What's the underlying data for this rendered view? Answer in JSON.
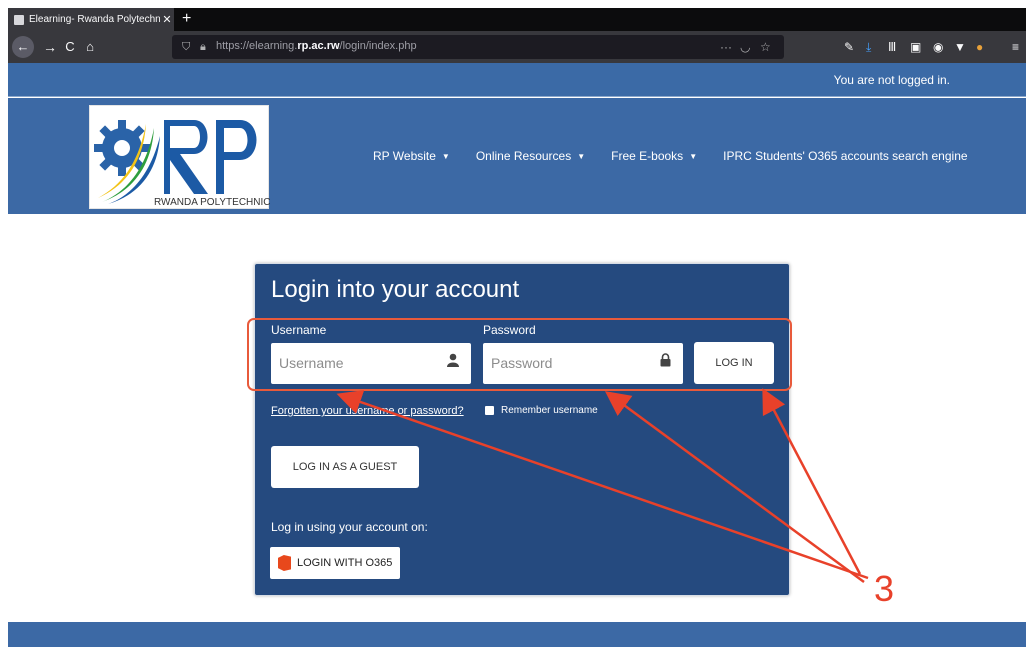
{
  "browser": {
    "tab_title": "Elearning- Rwanda Polytechnic",
    "tab_close": "✕",
    "new_tab": "+",
    "url_rest_prefix": "https://elearning.",
    "url_domain": "rp.ac.rw",
    "url_path": "/login/index.php",
    "icons": [
      "back-icon",
      "forward-icon",
      "reload-icon",
      "home-icon",
      "shield-icon",
      "lock-icon",
      "more-icon",
      "pocket-icon",
      "star-icon",
      "wrench-icon",
      "download-icon",
      "library-icon",
      "sidebar-icon",
      "account-icon",
      "extension-icon",
      "menu-icon"
    ]
  },
  "site": {
    "status": "You are not logged in.",
    "logo_text": "RP",
    "logo_sub": "RWANDA POLYTECHNIC",
    "nav": [
      {
        "label": "RP Website",
        "caret": true
      },
      {
        "label": "Online Resources",
        "caret": true
      },
      {
        "label": "Free E-books",
        "caret": true
      },
      {
        "label": "IPRC Students' O365 accounts search engine",
        "caret": false
      }
    ],
    "brand_color": "#3c69a5"
  },
  "login": {
    "title": "Login into your account",
    "username_label": "Username",
    "username_placeholder": "Username",
    "password_label": "Password",
    "password_placeholder": "Password",
    "login_button": "LOG IN",
    "forgot_link": "Forgotten your username or password?",
    "remember_label": "Remember username",
    "guest_button": "LOG IN AS A GUEST",
    "account_on_label": "Log in using your account on:",
    "o365_button": "LOGIN WITH O365",
    "panel_color": "#254a7f"
  },
  "annotation": {
    "number": "3",
    "color": "#e8412a"
  }
}
